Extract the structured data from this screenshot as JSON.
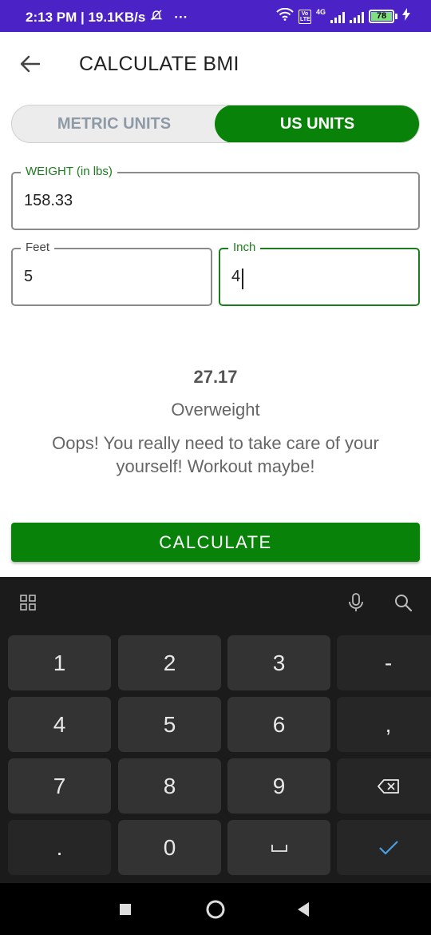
{
  "status_bar": {
    "time_speed": "2:13 PM | 19.1KB/s",
    "more": "···",
    "volte": "Vo LTE",
    "network": "4G",
    "battery": "78"
  },
  "app_bar": {
    "title": "CALCULATE BMI"
  },
  "unit_toggle": {
    "options": [
      "METRIC UNITS",
      "US UNITS"
    ],
    "selected": "US UNITS"
  },
  "form": {
    "weight": {
      "label": "WEIGHT (in lbs)",
      "value": "158.33"
    },
    "feet": {
      "label": "Feet",
      "value": "5"
    },
    "inch": {
      "label": "Inch",
      "value": "4"
    }
  },
  "result": {
    "bmi": "27.17",
    "category": "Overweight",
    "message": "Oops! You really need to take care of your yourself! Workout maybe!"
  },
  "calculate_button": "CALCULATE",
  "keyboard": {
    "rows": [
      [
        "1",
        "2",
        "3",
        "-"
      ],
      [
        "4",
        "5",
        "6",
        ","
      ],
      [
        "7",
        "8",
        "9",
        "⌫"
      ],
      [
        ".",
        "0",
        "␣",
        "✓"
      ]
    ]
  },
  "colors": {
    "status_bar": "#4a22c6",
    "accent_green": "#088208",
    "keyboard_bg": "#1b1b1b",
    "key_bg": "#333333",
    "confirm_blue": "#4a9fe0"
  }
}
